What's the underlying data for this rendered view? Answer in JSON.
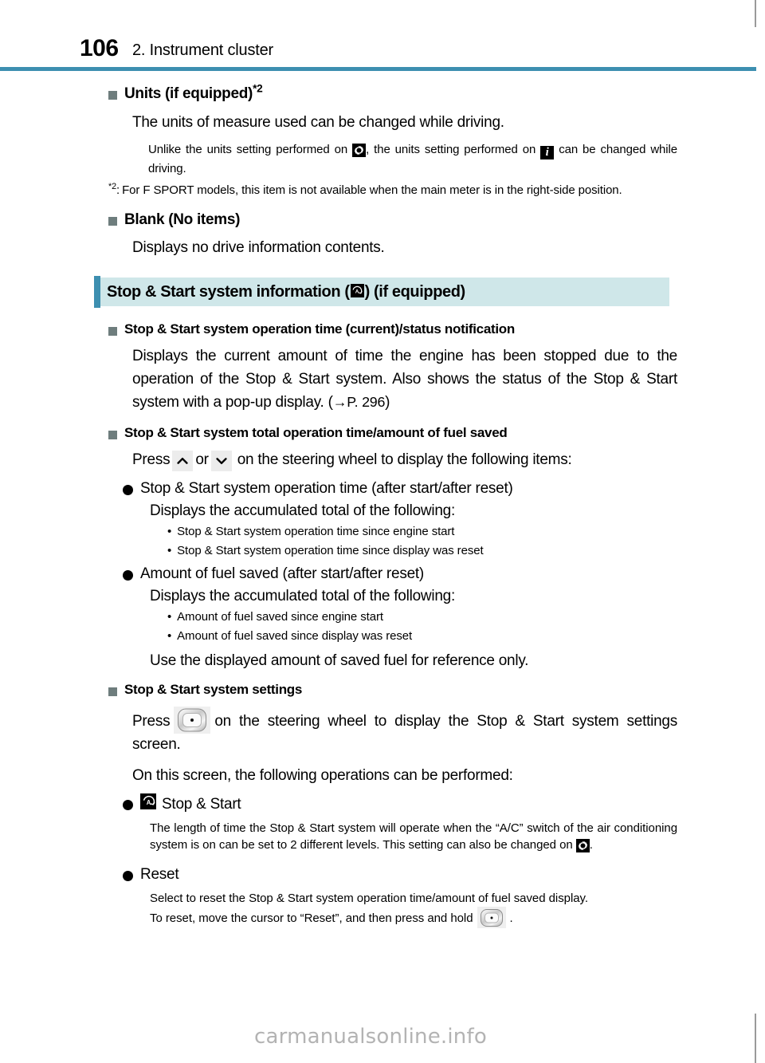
{
  "page": {
    "number": "106",
    "chapter_title": "2. Instrument cluster",
    "accent_color": "#3d8fb0",
    "banner_bg_color": "#cfe7e9",
    "bullet_color": "#6e7d7d"
  },
  "footer": {
    "watermark": "carmanualsonline.info"
  },
  "blocks": {
    "units_heading": "Units (if equipped)",
    "units_heading_sup": "*2",
    "units_body": "The units of measure used can be changed while driving.",
    "units_note_part1": "Unlike the units setting performed on",
    "units_note_part2": ", the units setting performed on",
    "units_note_part3": "can be changed while driving.",
    "footnote_mark": "*2",
    "footnote_colon": ":",
    "footnote_text": "For F SPORT models, this item is not available when the main meter is in the right-side position.",
    "blank_heading": "Blank (No items)",
    "blank_body": "Displays no drive information contents."
  },
  "section": {
    "title_before_icon": "Stop & Start system information (",
    "title_after_icon": ") (if equipped)",
    "icon_name": "stop-start-icon"
  },
  "items": {
    "op_time_heading": "Stop & Start system operation time (current)/status notification",
    "op_time_body": "Displays the current amount of time the engine has been stopped due to the operation of the Stop & Start system. Also shows the status of the Stop & Start system with a pop-up display. (",
    "op_time_ref_arrow": "→",
    "op_time_ref_page": "P. 296",
    "op_time_body_end": ")",
    "total_heading": "Stop & Start system total operation time/amount of fuel saved",
    "press_prefix": "Press",
    "press_or": "or",
    "press_suffix": "on the steering wheel to display the following items:",
    "bullet1": "Stop & Start system operation time (after start/after reset)",
    "bullet1_sub": "Displays the accumulated total of the following:",
    "bullet1_dots": [
      "Stop & Start system operation time since engine start",
      "Stop & Start system operation time since display was reset"
    ],
    "bullet2": "Amount of fuel saved (after start/after reset)",
    "bullet2_sub": "Displays the accumulated total of the following:",
    "bullet2_dots": [
      "Amount of fuel saved since engine start",
      "Amount of fuel saved since display was reset"
    ],
    "reference_note": "Use the displayed amount of saved fuel for reference only.",
    "settings_heading": "Stop & Start system settings",
    "settings_press_prefix": "Press",
    "settings_press_suffix": "on the steering wheel to display the Stop & Start system settings screen.",
    "on_screen_intro": "On this screen, the following operations can be performed:",
    "stopstart_label": "Stop & Start",
    "stopstart_body_1": "The length of time the Stop & Start system will operate when the “A/C” switch of the air conditioning system is on can be set to 2 different levels. This setting can also be changed on",
    "stopstart_body_2": ".",
    "reset_label": "Reset",
    "reset_body": "Select to reset the Stop & Start system operation time/amount of fuel saved display.",
    "reset_body2_prefix": "To reset, move the cursor to “Reset”, and then press and hold",
    "reset_body2_suffix": "."
  },
  "icons": {
    "gear": "gear-icon",
    "info": "info-icon",
    "stop_start": "stop-start-icon",
    "chevron_up": "chevron-up-icon",
    "chevron_down": "chevron-down-icon",
    "enter_switch": "enter-switch-icon"
  }
}
